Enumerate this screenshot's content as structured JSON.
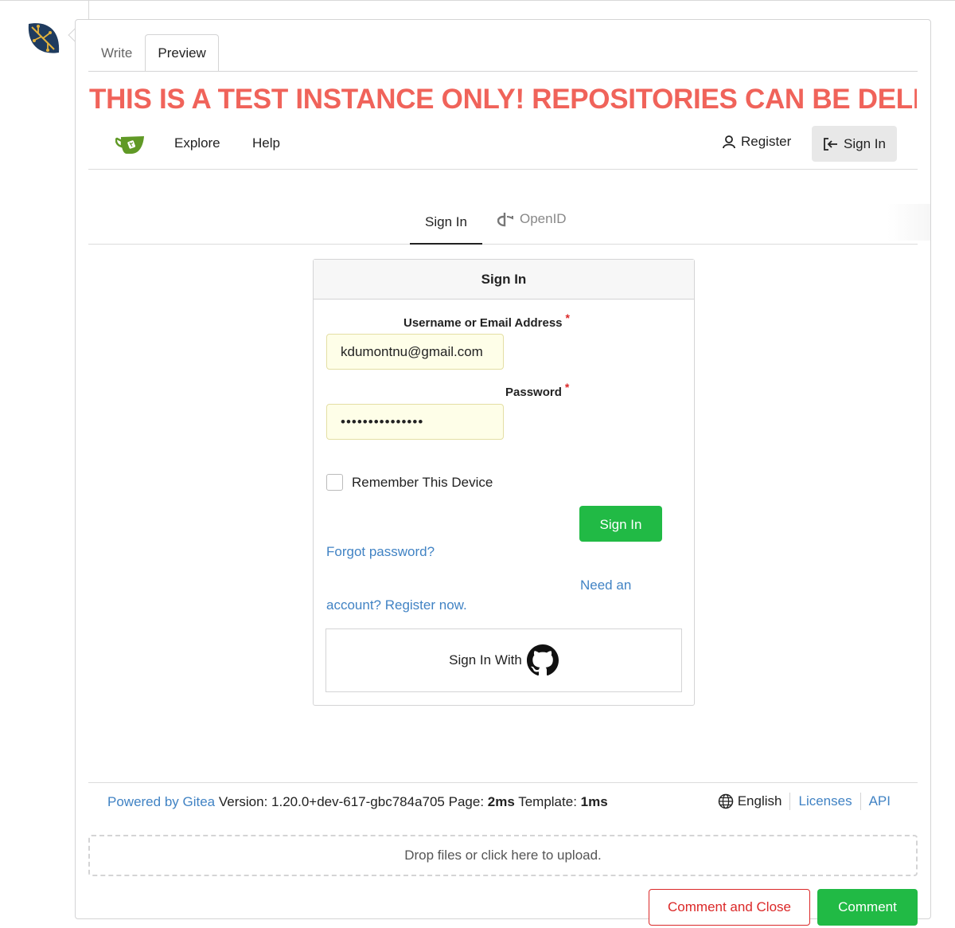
{
  "colors": {
    "banner": "#f0635a",
    "link": "#4183c4",
    "primary_button": "#21ba45",
    "danger": "#db2828",
    "autofill": "#fefee8"
  },
  "editor": {
    "tabs": [
      {
        "label": "Write",
        "active": false
      },
      {
        "label": "Preview",
        "active": true
      }
    ]
  },
  "preview": {
    "banner": "THIS IS A TEST INSTANCE ONLY! REPOSITORIES CAN BE DELETED AT",
    "navbar": {
      "logo_icon": "gitea-teacup-icon",
      "explore": "Explore",
      "help": "Help",
      "register": "Register",
      "sign_in": "Sign In"
    },
    "auth_tabs": {
      "sign_in": "Sign In",
      "openid": "OpenID"
    },
    "form": {
      "title": "Sign In",
      "username_label": "Username or Email Address",
      "username_value": "kdumontnu@gmail.com",
      "password_label": "Password",
      "password_value": "•••••••••••••••",
      "required_mark": "*",
      "remember_label": "Remember This Device",
      "remember_checked": false,
      "submit_label": "Sign In",
      "forgot_link": "Forgot password?",
      "register_line1": "Need an",
      "register_line2": "account? Register now.",
      "oauth_label": "Sign In With",
      "oauth_icon": "github-icon"
    },
    "footer": {
      "powered_by": "Powered by Gitea",
      "version_text": " Version: 1.20.0+dev-617-gbc784a705 Page: ",
      "page_time": "2ms",
      "template_label": " Template: ",
      "template_time": "1ms",
      "language": "English",
      "licenses": "Licenses",
      "api": "API"
    }
  },
  "dropzone": "Drop files or click here to upload.",
  "actions": {
    "comment_and_close": "Comment and Close",
    "comment": "Comment"
  }
}
